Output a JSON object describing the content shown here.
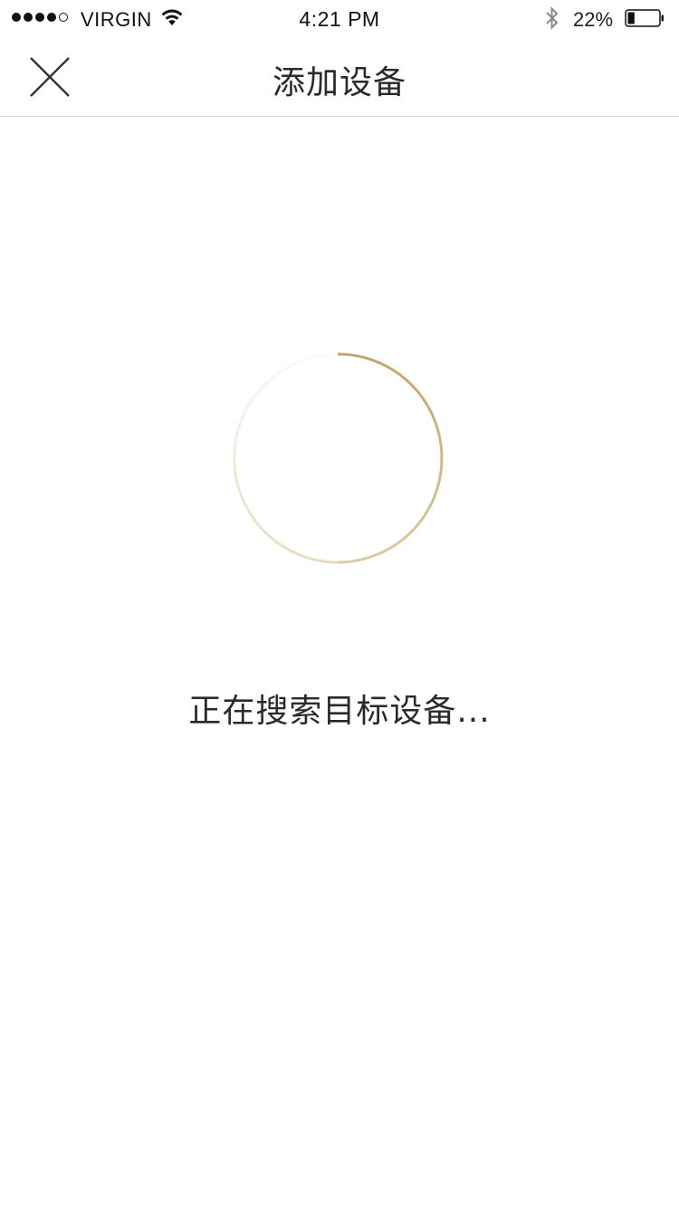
{
  "status_bar": {
    "signal_bars_filled": 4,
    "signal_bars_total": 5,
    "carrier": "VIRGIN",
    "time": "4:21 PM",
    "battery_percent": "22%",
    "battery_level": 0.22,
    "icons": [
      "signal-dots-icon",
      "wifi-icon",
      "bluetooth-icon",
      "battery-icon"
    ]
  },
  "nav": {
    "close_icon": "close-icon",
    "title": "添加设备"
  },
  "content": {
    "spinner_icon": "loading-spinner-icon",
    "status_text": "正在搜索目标设备..."
  },
  "colors": {
    "accent_gold": "#c7ab72",
    "text": "#2a2a2a",
    "divider": "#d6d6d6",
    "background": "#ffffff"
  }
}
